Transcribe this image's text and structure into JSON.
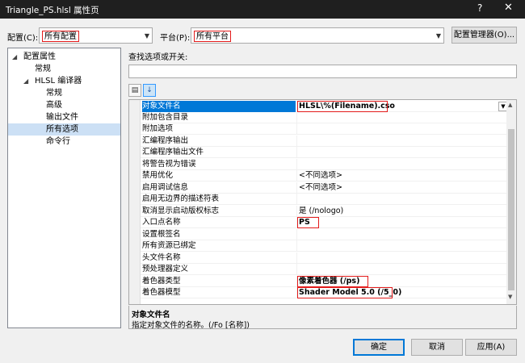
{
  "window": {
    "title": "Triangle_PS.hlsl 属性页",
    "help": "?",
    "close": "✕"
  },
  "config": {
    "label": "配置(C):",
    "value": "所有配置"
  },
  "platform": {
    "label": "平台(P):",
    "value": "所有平台"
  },
  "config_manager_label": "配置管理器(O)...",
  "tree": [
    {
      "label": "配置属性",
      "expander": "◢"
    },
    {
      "label": "常规"
    },
    {
      "label": "HLSL 编译器",
      "expander": "◢"
    },
    {
      "label": "常规"
    },
    {
      "label": "高级"
    },
    {
      "label": "输出文件"
    },
    {
      "label": "所有选项",
      "selected": true
    },
    {
      "label": "命令行"
    }
  ],
  "search": {
    "label": "查找选项或开关:",
    "value": ""
  },
  "toolbar": {
    "categorized_icon": "categorized-icon",
    "sort_icon": "sort-alphabetical-icon"
  },
  "properties": [
    {
      "name": "对象文件名",
      "value": "HLSL\\%(Filename).cso"
    },
    {
      "name": "附加包含目录",
      "value": ""
    },
    {
      "name": "附加选项",
      "value": ""
    },
    {
      "name": "汇编程序输出",
      "value": ""
    },
    {
      "name": "汇编程序输出文件",
      "value": ""
    },
    {
      "name": "将警告视为错误",
      "value": ""
    },
    {
      "name": "禁用优化",
      "value": "<不同选项>"
    },
    {
      "name": "启用调试信息",
      "value": "<不同选项>"
    },
    {
      "name": "启用无边界的描述符表",
      "value": ""
    },
    {
      "name": "取消显示启动版权标志",
      "value": "是 (/nologo)"
    },
    {
      "name": "入口点名称",
      "value": "PS"
    },
    {
      "name": "设置根签名",
      "value": ""
    },
    {
      "name": "所有资源已绑定",
      "value": ""
    },
    {
      "name": "头文件名称",
      "value": ""
    },
    {
      "name": "预处理器定义",
      "value": ""
    },
    {
      "name": "着色器类型",
      "value": "像素着色器 (/ps)"
    },
    {
      "name": "着色器模型",
      "value": "Shader Model 5.0 (/5_0)"
    }
  ],
  "description": {
    "title": "对象文件名",
    "text": "指定对象文件的名称。(/Fo [名称])"
  },
  "buttons": {
    "ok": "确定",
    "cancel": "取消",
    "apply": "应用(A)"
  }
}
